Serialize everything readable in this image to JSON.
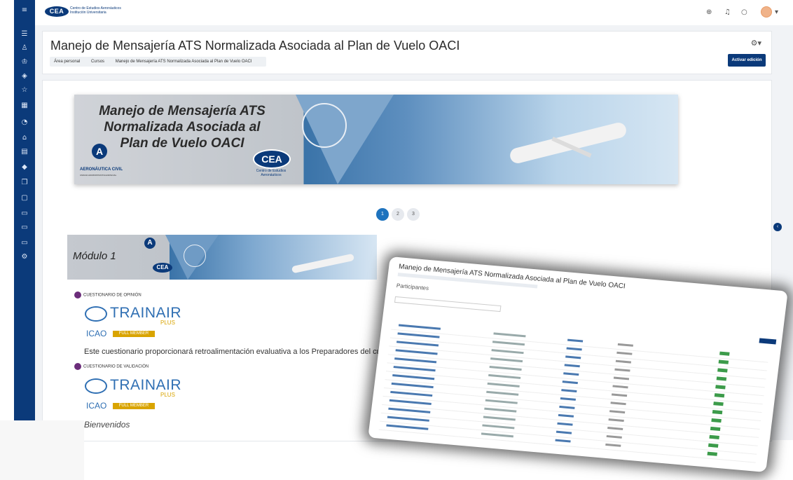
{
  "topbar": {
    "logo": "CEA",
    "logo_sub": "Centro de Estudios Aeronáuticos Institución Universitaria"
  },
  "header": {
    "title": "Manejo de Mensajería ATS Normalizada Asociada al Plan de Vuelo OACI",
    "breadcrumb": [
      "Área personal",
      "Cursos",
      "Manejo de Mensajería ATS Normalizada Asociada al Plan de Vuelo OACI"
    ],
    "edit_button": "Activar edición"
  },
  "banner": {
    "title": "Manejo de Mensajería ATS Normalizada Asociada al Plan de Vuelo OACI",
    "org_left": "AERONÁUTICA CIVIL",
    "org_left_sub": "UNIDAD ADMINISTRATIVA ESPECIAL",
    "org_right": "CEA",
    "org_right_sub": "Centro de Estudios Aeronáuticos"
  },
  "pager": [
    "1",
    "2",
    "3"
  ],
  "module": {
    "title": "Módulo 1",
    "logo": "CEA"
  },
  "activities": [
    {
      "label": "CUESTIONARIO DE OPINIÓN"
    },
    {
      "label": "CUESTIONARIO DE VALIDACIÓN"
    }
  ],
  "trainair": {
    "word": "TRAINAIR",
    "plus": "PLUS",
    "icao": "ICAO",
    "member": "FULL MEMBER"
  },
  "description": "Este cuestionario proporcionará retroalimentación evaluativa a los Preparadores del cu",
  "welcome": "Bienvenidos",
  "overlay": {
    "title": "Manejo de Mensajería ATS Normalizada Asociada al Plan de Vuelo OACI",
    "subtitle": "Participantes"
  },
  "colors": {
    "sidebar": "#0b3a7a",
    "accent": "#1e73be"
  }
}
